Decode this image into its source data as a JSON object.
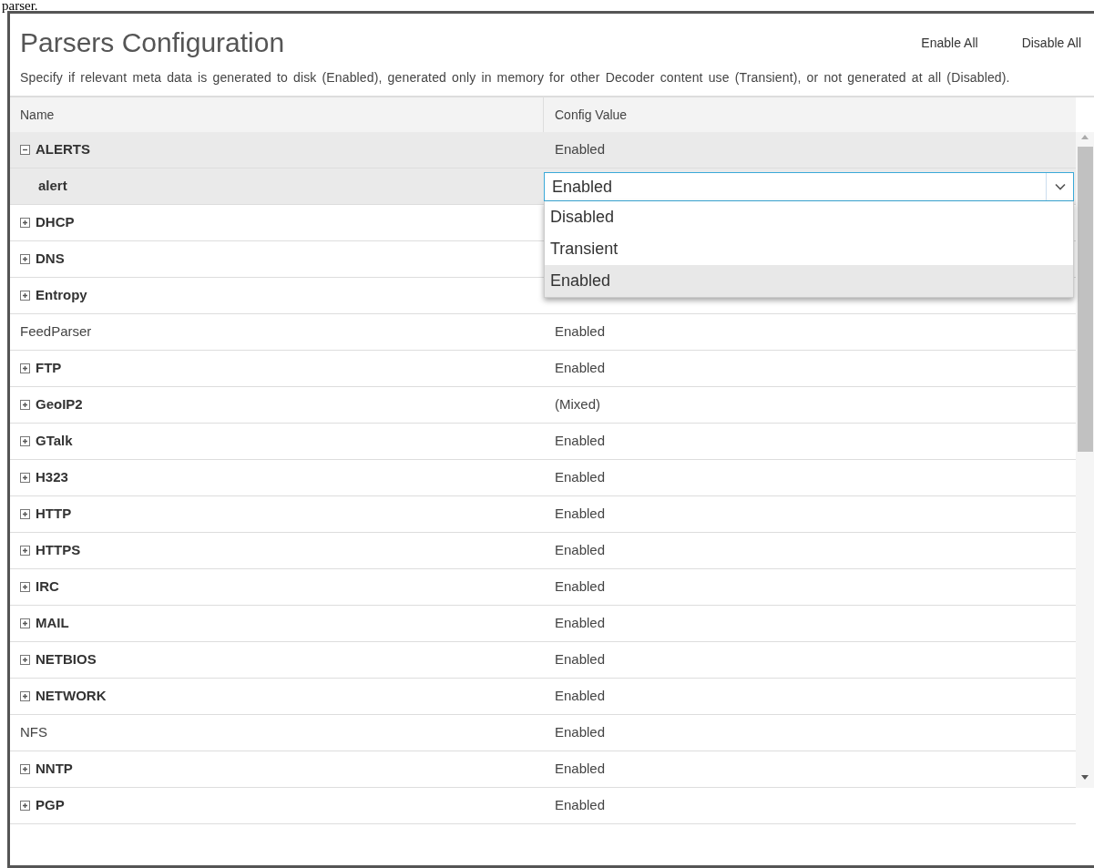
{
  "caption_above": "parser.",
  "header": {
    "title": "Parsers Configuration",
    "actions": [
      "Enable All",
      "Disable All"
    ],
    "description": "Specify if relevant meta data is generated to disk (Enabled), generated only in memory for other Decoder content use (Transient), or not generated at all (Disabled)."
  },
  "table": {
    "columns": [
      "Name",
      "Config Value"
    ],
    "rows": [
      {
        "name": "ALERTS",
        "kind": "group",
        "expanded": true,
        "selected": true,
        "value": "Enabled",
        "children": [
          {
            "name": "alert",
            "kind": "child",
            "selected": true,
            "editor": {
              "value": "Enabled",
              "options": [
                {
                  "label": "Disabled",
                  "selected": false
                },
                {
                  "label": "Transient",
                  "selected": false
                },
                {
                  "label": "Enabled",
                  "selected": true
                }
              ]
            }
          }
        ]
      },
      {
        "name": "DHCP",
        "kind": "group",
        "expanded": false,
        "selected": false
      },
      {
        "name": "DNS",
        "kind": "group",
        "expanded": false,
        "selected": false
      },
      {
        "name": "Entropy",
        "kind": "group",
        "expanded": false,
        "selected": false
      },
      {
        "name": "FeedParser",
        "kind": "leaf",
        "selected": false,
        "value": "Enabled"
      },
      {
        "name": "FTP",
        "kind": "group",
        "expanded": false,
        "selected": false,
        "value": "Enabled"
      },
      {
        "name": "GeoIP2",
        "kind": "group",
        "expanded": false,
        "selected": false,
        "value": "(Mixed)"
      },
      {
        "name": "GTalk",
        "kind": "group",
        "expanded": false,
        "selected": false,
        "value": "Enabled"
      },
      {
        "name": "H323",
        "kind": "group",
        "expanded": false,
        "selected": false,
        "value": "Enabled"
      },
      {
        "name": "HTTP",
        "kind": "group",
        "expanded": false,
        "selected": false,
        "value": "Enabled"
      },
      {
        "name": "HTTPS",
        "kind": "group",
        "expanded": false,
        "selected": false,
        "value": "Enabled"
      },
      {
        "name": "IRC",
        "kind": "group",
        "expanded": false,
        "selected": false,
        "value": "Enabled"
      },
      {
        "name": "MAIL",
        "kind": "group",
        "expanded": false,
        "selected": false,
        "value": "Enabled"
      },
      {
        "name": "NETBIOS",
        "kind": "group",
        "expanded": false,
        "selected": false,
        "value": "Enabled"
      },
      {
        "name": "NETWORK",
        "kind": "group",
        "expanded": false,
        "selected": false,
        "value": "Enabled"
      },
      {
        "name": "NFS",
        "kind": "leaf",
        "selected": false,
        "value": "Enabled"
      },
      {
        "name": "NNTP",
        "kind": "group",
        "expanded": false,
        "selected": false,
        "value": "Enabled"
      },
      {
        "name": "PGP",
        "kind": "group",
        "expanded": false,
        "selected": false,
        "value": "Enabled"
      }
    ]
  }
}
